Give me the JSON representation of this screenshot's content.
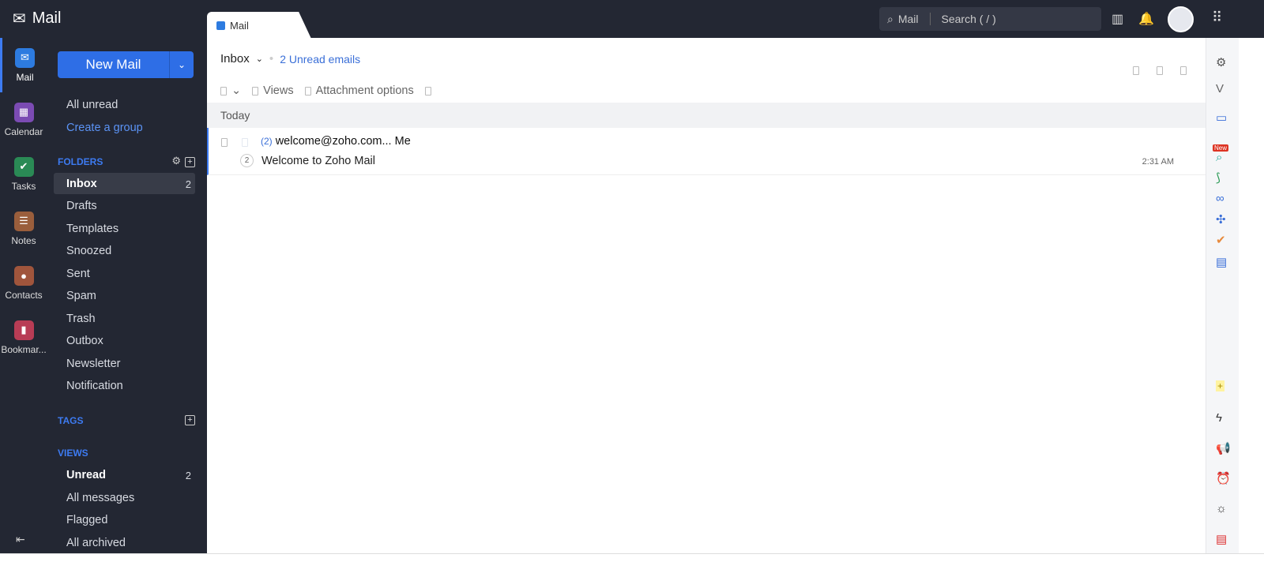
{
  "app": {
    "title": "Mail",
    "tab": "Mail"
  },
  "search": {
    "scope": "Mail",
    "placeholder": "Search ( / )"
  },
  "rail": [
    {
      "label": "Mail",
      "icon": "mail-icon",
      "color": "#2d7be0"
    },
    {
      "label": "Calendar",
      "icon": "calendar-icon",
      "color": "#7b4bb3"
    },
    {
      "label": "Tasks",
      "icon": "check-icon",
      "color": "#2a8a55"
    },
    {
      "label": "Notes",
      "icon": "notes-icon",
      "color": "#9a5e3c"
    },
    {
      "label": "Contacts",
      "icon": "contact-icon",
      "color": "#a0553c"
    },
    {
      "label": "Bookmar...",
      "icon": "bookmark-icon",
      "color": "#b83c55"
    }
  ],
  "new_mail": "New Mail",
  "quick": [
    "All unread",
    "Create a group"
  ],
  "folders_title": "FOLDERS",
  "folders": [
    {
      "label": "Inbox",
      "count": "2"
    },
    {
      "label": "Drafts"
    },
    {
      "label": "Templates"
    },
    {
      "label": "Snoozed"
    },
    {
      "label": "Sent"
    },
    {
      "label": "Spam"
    },
    {
      "label": "Trash"
    },
    {
      "label": "Outbox"
    },
    {
      "label": "Newsletter"
    },
    {
      "label": "Notification"
    }
  ],
  "tags_title": "TAGS",
  "views_title": "VIEWS",
  "views": [
    {
      "label": "Unread",
      "count": "2"
    },
    {
      "label": "All messages"
    },
    {
      "label": "Flagged"
    },
    {
      "label": "All archived"
    }
  ],
  "main": {
    "folder": "Inbox",
    "unread": "2 Unread emails",
    "views": "Views",
    "attachment": "Attachment options",
    "group": "Today"
  },
  "emails": [
    {
      "thread_count": "(2)",
      "from": "welcome@zoho.com... Me",
      "count": "2",
      "subject": "Welcome to Zoho Mail",
      "time": "2:31 AM"
    }
  ],
  "right_badge": "New"
}
